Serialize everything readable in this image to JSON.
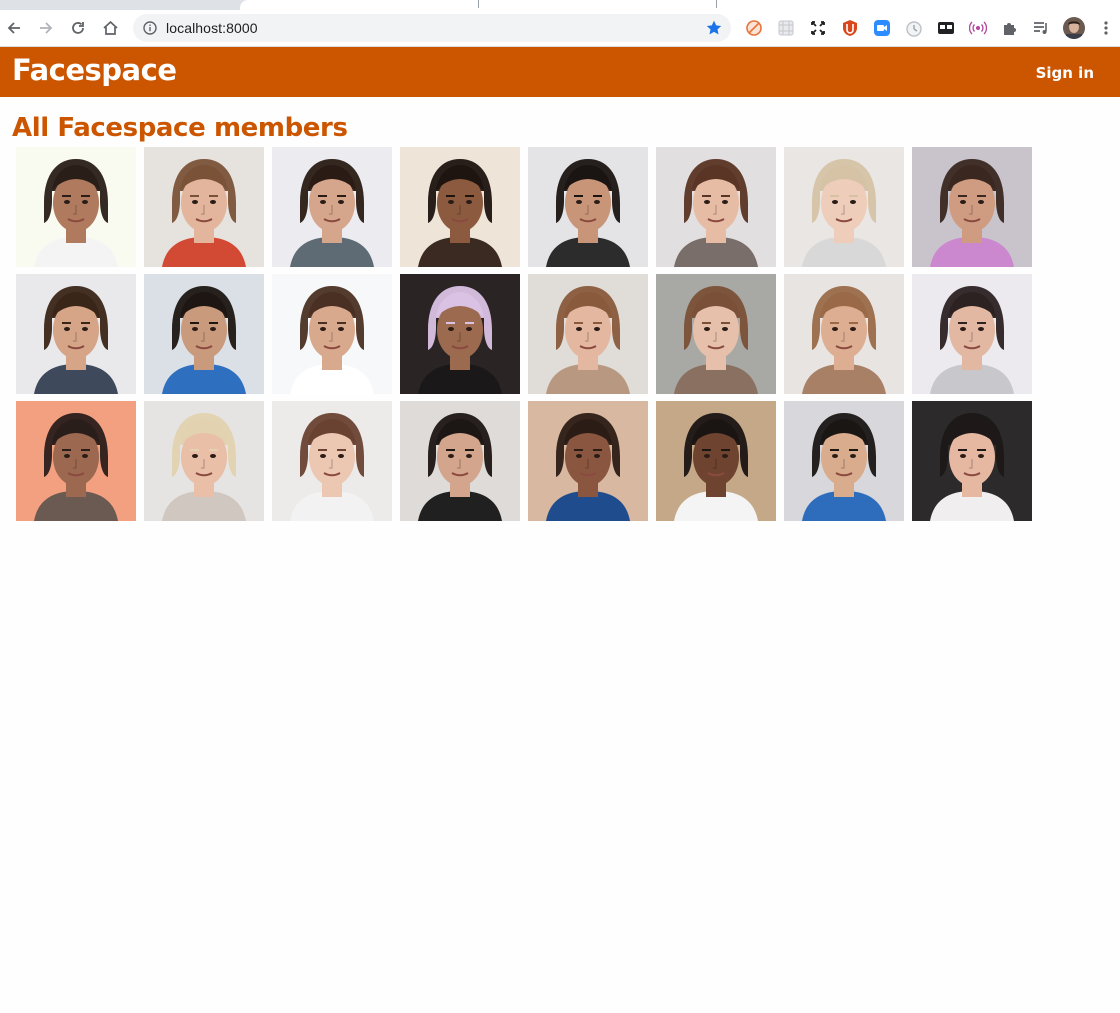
{
  "browser": {
    "url": "localhost:8000",
    "bookmarked": true
  },
  "site": {
    "brand": "Facespace",
    "signin_label": "Sign in",
    "brand_color": "#cc5500"
  },
  "page": {
    "title": "All Facespace members"
  },
  "members": [
    {
      "bg": "#fafbf0",
      "skin": "#b07a5e",
      "hair": "#2a1e18",
      "shirt": "#f4f4f4"
    },
    {
      "bg": "#e6e2de",
      "skin": "#e3b59c",
      "hair": "#7a5238",
      "shirt": "#d24a34"
    },
    {
      "bg": "#ececf0",
      "skin": "#d6a68c",
      "hair": "#2a1c14",
      "shirt": "#5e6a74"
    },
    {
      "bg": "#efe4d8",
      "skin": "#8c5a3e",
      "hair": "#1e1410",
      "shirt": "#3a2a22"
    },
    {
      "bg": "#e4e3e6",
      "skin": "#c99578",
      "hair": "#1a1412",
      "shirt": "#2c2c2c"
    },
    {
      "bg": "#e2dfe0",
      "skin": "#e7bca4",
      "hair": "#5a3424",
      "shirt": "#7a6e6a"
    },
    {
      "bg": "#e9e6e3",
      "skin": "#efcdbb",
      "hair": "#d6c3a6",
      "shirt": "#d8d8d8"
    },
    {
      "bg": "#c9c4cc",
      "skin": "#cf9c82",
      "hair": "#3a2820",
      "shirt": "#cc88cf"
    },
    {
      "bg": "#e9e9ec",
      "skin": "#d6a588",
      "hair": "#3a2618",
      "shirt": "#3e4a5c"
    },
    {
      "bg": "#dbe0e6",
      "skin": "#c99a7c",
      "hair": "#1e1612",
      "shirt": "#2f6fbf"
    },
    {
      "bg": "#f6f8fa",
      "skin": "#d9a98e",
      "hair": "#4a3022",
      "shirt": "#ffffff"
    },
    {
      "bg": "#2a2424",
      "skin": "#9c6a4e",
      "hair": "#d9c2e4",
      "shirt": "#1a1818"
    },
    {
      "bg": "#e0dcd8",
      "skin": "#e4b8a0",
      "hair": "#8a5a3c",
      "shirt": "#b89880"
    },
    {
      "bg": "#a8a8a4",
      "skin": "#e6c0aa",
      "hair": "#7a5038",
      "shirt": "#8a7060"
    },
    {
      "bg": "#e8e4e2",
      "skin": "#deae92",
      "hair": "#9a6a48",
      "shirt": "#a88066"
    },
    {
      "bg": "#eceaee",
      "skin": "#e2b8a2",
      "hair": "#2c2222",
      "shirt": "#c8c8cc"
    },
    {
      "bg": "#f2a080",
      "skin": "#9c6850",
      "hair": "#2a1e1a",
      "shirt": "#6a5a52"
    },
    {
      "bg": "#e6e4e2",
      "skin": "#e9bfa8",
      "hair": "#e2d2b0",
      "shirt": "#d0c8c0"
    },
    {
      "bg": "#ecebe9",
      "skin": "#ecc7b2",
      "hair": "#6a4232",
      "shirt": "#f2f2f2"
    },
    {
      "bg": "#dedbd9",
      "skin": "#d3a58c",
      "hair": "#1c1614",
      "shirt": "#202020"
    },
    {
      "bg": "#d8b8a0",
      "skin": "#8a5640",
      "hair": "#2c1c16",
      "shirt": "#1e4c8c"
    },
    {
      "bg": "#c4a888",
      "skin": "#6e4430",
      "hair": "#1a1412",
      "shirt": "#f4f4f4"
    },
    {
      "bg": "#d8d8dc",
      "skin": "#d8ac8c",
      "hair": "#1a1614",
      "shirt": "#2e6cbc"
    },
    {
      "bg": "#2c2a2a",
      "skin": "#e6b8a2",
      "hair": "#1e1818",
      "shirt": "#f0eeee"
    }
  ]
}
